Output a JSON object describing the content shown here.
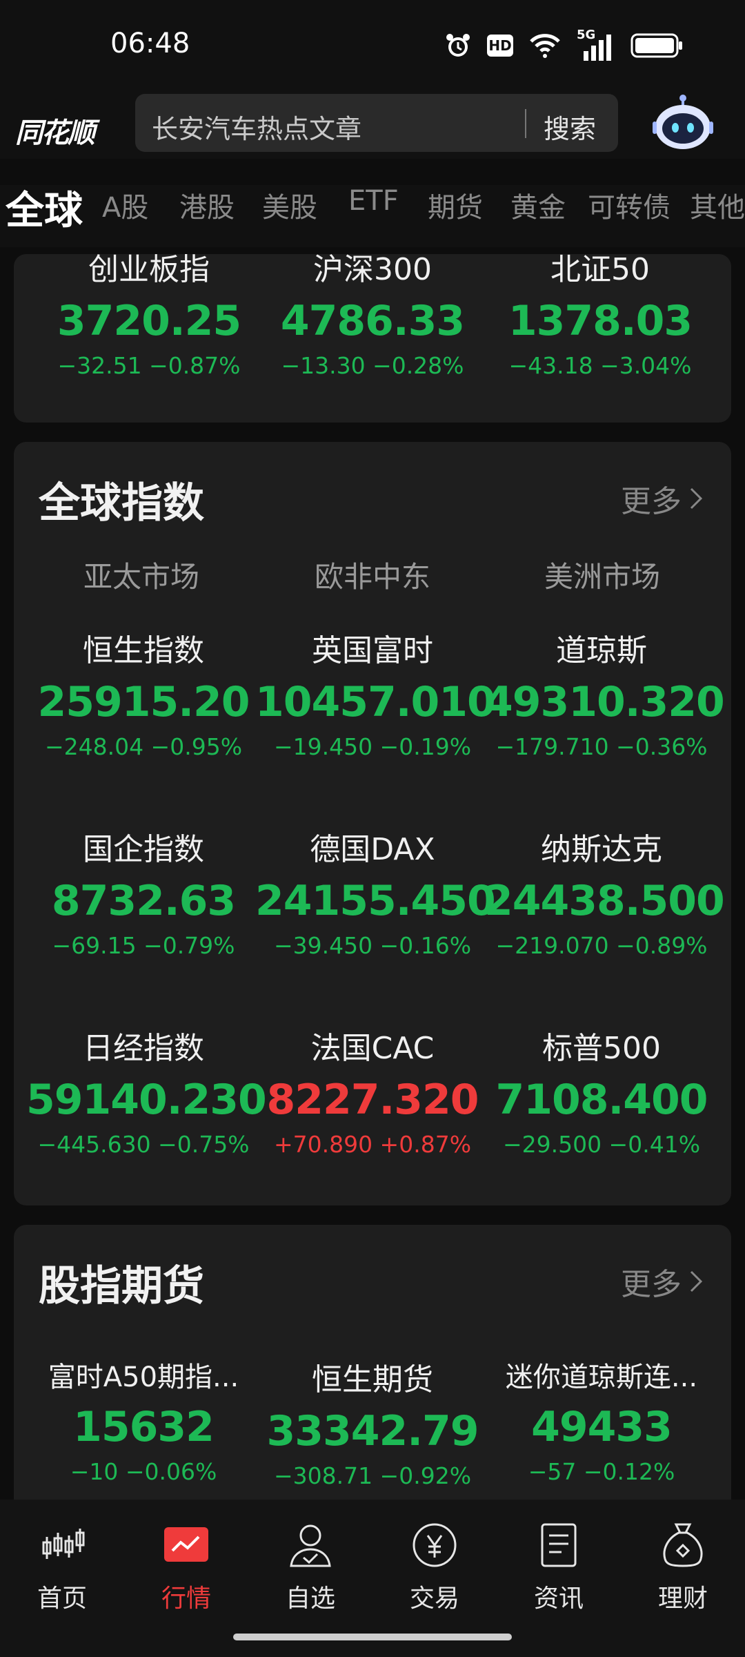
{
  "status_bar": {
    "time": "06:48",
    "icons": [
      "alarm-icon",
      "hd-icon",
      "wifi-icon",
      "5g-signal-icon",
      "battery-icon"
    ],
    "hd_text": "HD",
    "network_text": "5G"
  },
  "header": {
    "logo_text": "同花顺",
    "search_placeholder": "长安汽车热点文章",
    "search_button": "搜索"
  },
  "tabs": [
    {
      "label": "全球",
      "active": true
    },
    {
      "label": "A股",
      "active": false
    },
    {
      "label": "港股",
      "active": false
    },
    {
      "label": "美股",
      "active": false
    },
    {
      "label": "ETF",
      "active": false
    },
    {
      "label": "期货",
      "active": false
    },
    {
      "label": "黄金",
      "active": false
    },
    {
      "label": "可转债",
      "active": false
    },
    {
      "label": "其他",
      "active": false
    }
  ],
  "colors": {
    "up": "#ef3b3b",
    "down": "#1db955",
    "accent": "#ef3b3b",
    "card_bg": "#1e1e1e"
  },
  "top_partial": [
    {
      "name": "创业板指",
      "value": "3720.25",
      "change": "−32.51 −0.87%",
      "dir": "down"
    },
    {
      "name": "沪深300",
      "value": "4786.33",
      "change": "−13.30 −0.28%",
      "dir": "down"
    },
    {
      "name": "北证50",
      "value": "1378.03",
      "change": "−43.18 −3.04%",
      "dir": "down"
    }
  ],
  "global_indices": {
    "title": "全球指数",
    "more": "更多",
    "sub_tabs": [
      "亚太市场",
      "欧非中东",
      "美洲市场"
    ],
    "rows": [
      [
        {
          "name": "恒生指数",
          "value": "25915.20",
          "change": "−248.04 −0.95%",
          "dir": "down"
        },
        {
          "name": "英国富时",
          "value": "10457.010",
          "change": "−19.450 −0.19%",
          "dir": "down"
        },
        {
          "name": "道琼斯",
          "value": "49310.320",
          "change": "−179.710 −0.36%",
          "dir": "down"
        }
      ],
      [
        {
          "name": "国企指数",
          "value": "8732.63",
          "change": "−69.15 −0.79%",
          "dir": "down"
        },
        {
          "name": "德国DAX",
          "value": "24155.450",
          "change": "−39.450 −0.16%",
          "dir": "down"
        },
        {
          "name": "纳斯达克",
          "value": "24438.500",
          "change": "−219.070 −0.89%",
          "dir": "down"
        }
      ],
      [
        {
          "name": "日经指数",
          "value": "59140.230",
          "change": "−445.630 −0.75%",
          "dir": "down"
        },
        {
          "name": "法国CAC",
          "value": "8227.320",
          "change": "+70.890 +0.87%",
          "dir": "up"
        },
        {
          "name": "标普500",
          "value": "7108.400",
          "change": "−29.500 −0.41%",
          "dir": "down"
        }
      ]
    ]
  },
  "futures": {
    "title": "股指期货",
    "more": "更多",
    "items": [
      {
        "name": "富时A50期指...",
        "value": "15632",
        "change": "−10 −0.06%",
        "dir": "down"
      },
      {
        "name": "恒生期货",
        "value": "33342.79",
        "change": "−308.71 −0.92%",
        "dir": "down"
      },
      {
        "name": "迷你道琼斯连...",
        "value": "49433",
        "change": "−57 −0.12%",
        "dir": "down"
      }
    ]
  },
  "bottom_nav": [
    {
      "label": "首页",
      "icon": "candlestick-icon",
      "active": false
    },
    {
      "label": "行情",
      "icon": "market-chart-icon",
      "active": true
    },
    {
      "label": "自选",
      "icon": "user-check-icon",
      "active": false
    },
    {
      "label": "交易",
      "icon": "yen-coin-icon",
      "active": false
    },
    {
      "label": "资讯",
      "icon": "news-document-icon",
      "active": false
    },
    {
      "label": "理财",
      "icon": "money-bag-icon",
      "active": false
    }
  ]
}
